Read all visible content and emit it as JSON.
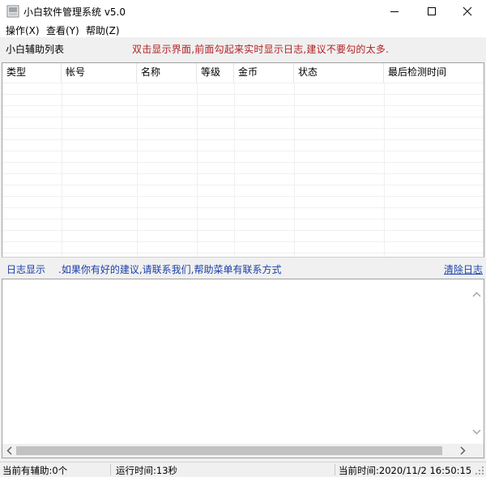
{
  "window": {
    "title": "小白软件管理系统    v5.0"
  },
  "menu": [
    {
      "label": "操作(X)"
    },
    {
      "label": "查看(Y)"
    },
    {
      "label": "帮助(Z)"
    }
  ],
  "helper_list": {
    "title": "小白辅助列表",
    "hint": "双击显示界面,前面勾起来实时显示日志,建议不要勾的太多."
  },
  "table": {
    "columns": [
      "类型",
      "帐号",
      "名称",
      "等级",
      "金币",
      "状态",
      "最后检测时间"
    ],
    "rows": []
  },
  "log": {
    "label": "日志显示",
    "hint": ".如果你有好的建议,请联系我们,帮助菜单有联系方式",
    "clear_label": "清除日志",
    "content": ""
  },
  "status": {
    "helpers": "当前有辅助:0个",
    "runtime": "运行时间:13秒",
    "now": "当前时间:2020/11/2 16:50:15"
  },
  "colors": {
    "hint": "#b22222",
    "link": "#1a3fa8"
  }
}
